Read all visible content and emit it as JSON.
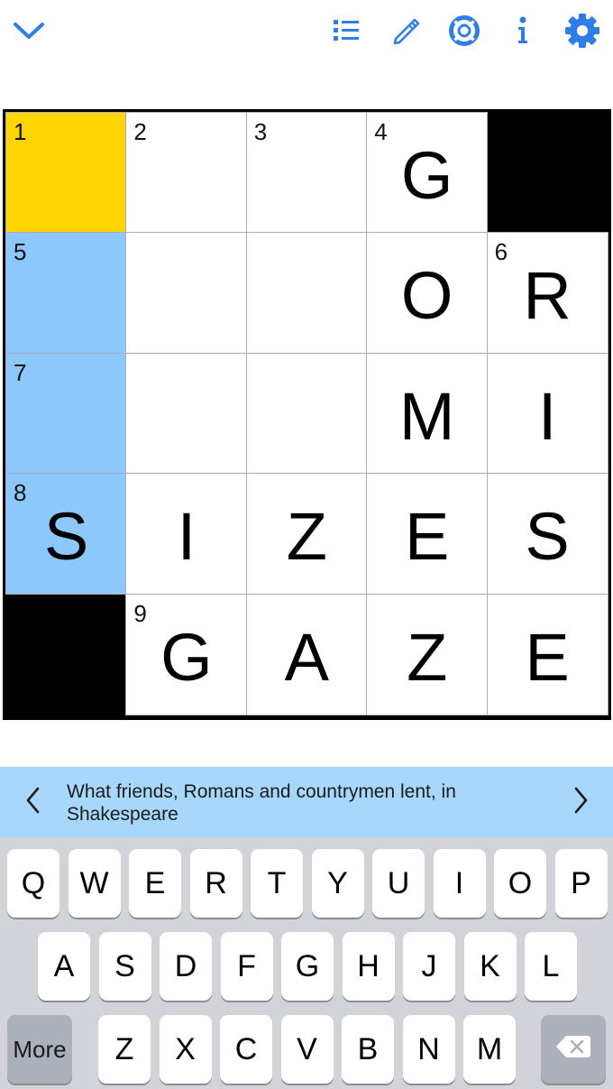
{
  "toolbar": {
    "collapse_icon": "chevron-down-icon",
    "clue_list_icon": "list-icon",
    "pencil_icon": "pencil-icon",
    "help_icon": "lifebuoy-icon",
    "info_icon": "info-icon",
    "settings_icon": "gear-icon",
    "accent_color": "#2f7ee8"
  },
  "grid": {
    "colors": {
      "active": "#ffd500",
      "word": "#8cc8fc",
      "black": "#000000",
      "white": "#ffffff"
    },
    "rows": [
      [
        {
          "num": "1",
          "letter": "",
          "state": "active"
        },
        {
          "num": "2",
          "letter": ""
        },
        {
          "num": "3",
          "letter": ""
        },
        {
          "num": "4",
          "letter": "G"
        },
        {
          "black": true
        }
      ],
      [
        {
          "num": "5",
          "letter": "",
          "state": "word"
        },
        {
          "num": "",
          "letter": ""
        },
        {
          "num": "",
          "letter": ""
        },
        {
          "num": "",
          "letter": "O"
        },
        {
          "num": "6",
          "letter": "R"
        }
      ],
      [
        {
          "num": "7",
          "letter": "",
          "state": "word"
        },
        {
          "num": "",
          "letter": ""
        },
        {
          "num": "",
          "letter": ""
        },
        {
          "num": "",
          "letter": "M"
        },
        {
          "num": "",
          "letter": "I"
        }
      ],
      [
        {
          "num": "8",
          "letter": "S",
          "state": "word"
        },
        {
          "num": "",
          "letter": "I"
        },
        {
          "num": "",
          "letter": "Z"
        },
        {
          "num": "",
          "letter": "E"
        },
        {
          "num": "",
          "letter": "S"
        }
      ],
      [
        {
          "black": true
        },
        {
          "num": "9",
          "letter": "G"
        },
        {
          "num": "",
          "letter": "A"
        },
        {
          "num": "",
          "letter": "Z"
        },
        {
          "num": "",
          "letter": "E"
        }
      ]
    ]
  },
  "clue_bar": {
    "text": "What friends, Romans and countrymen lent, in Shakespeare",
    "prev_icon": "chevron-left-icon",
    "next_icon": "chevron-right-icon",
    "background": "#a8d7fd"
  },
  "keyboard": {
    "row1": [
      "Q",
      "W",
      "E",
      "R",
      "T",
      "Y",
      "U",
      "I",
      "O",
      "P"
    ],
    "row2": [
      "A",
      "S",
      "D",
      "F",
      "G",
      "H",
      "J",
      "K",
      "L"
    ],
    "row3": [
      "Z",
      "X",
      "C",
      "V",
      "B",
      "N",
      "M"
    ],
    "more_label": "More",
    "delete_icon": "backspace-icon"
  }
}
